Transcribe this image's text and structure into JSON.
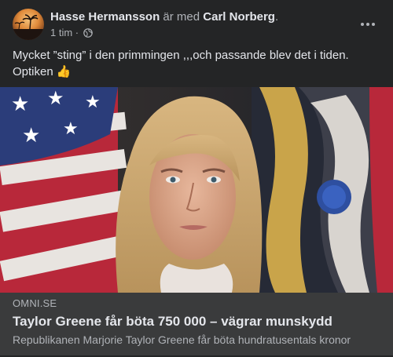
{
  "post": {
    "author": "Hasse Hermansson",
    "with_text": "är med",
    "tagged": "Carl Norberg",
    "tag_period": ".",
    "time": "1 tim",
    "separator": "·",
    "privacy_icon": "globe-icon",
    "more_icon": "more-dots-icon",
    "body_line1": "Mycket ”sting” i den primmingen ,,,och passande blev det i tiden.",
    "body_line2": "Optiken",
    "body_emoji": "👍"
  },
  "link_preview": {
    "domain": "OMNI.SE",
    "headline": "Taylor Greene får böta 750 000 – vägrar munskydd",
    "description": "Republikanen Marjorie Taylor Greene får böta hundratusentals kronor"
  },
  "colors": {
    "background": "#242526",
    "link_box": "#3a3b3c",
    "primary_text": "#e4e6eb",
    "secondary_text": "#b0b3b8"
  }
}
